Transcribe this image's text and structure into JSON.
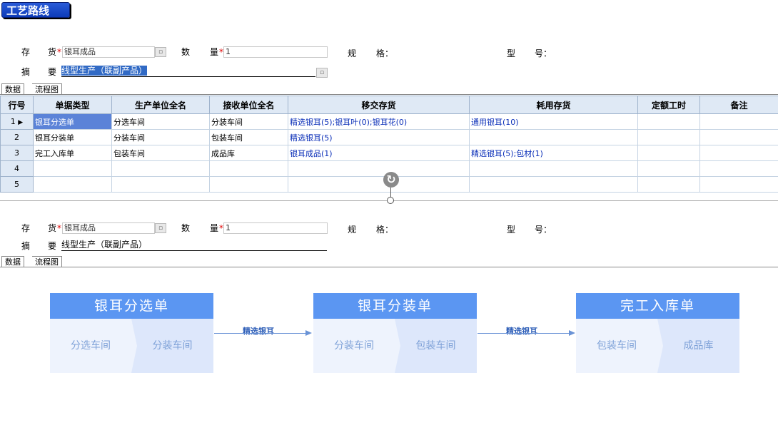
{
  "title": "工艺路线",
  "form": {
    "inventory_label_a": "存",
    "inventory_label_b": "货",
    "inventory_value": "银耳成品",
    "quantity_label_a": "数",
    "quantity_label_b": "量",
    "quantity_value": "1",
    "spec_label_a": "规",
    "spec_label_b": "格：",
    "model_label_a": "型",
    "model_label_b": "号：",
    "summary_label_a": "摘",
    "summary_label_b": "要",
    "summary_value": "线型生产（联副产品）",
    "required_mark": "*",
    "lookup_glyph": "▫"
  },
  "tabs": {
    "data": "数据",
    "flow": "流程图"
  },
  "grid": {
    "headers": [
      "行号",
      "单据类型",
      "生产单位全名",
      "接收单位全名",
      "移交存货",
      "耗用存货",
      "定额工时",
      "备注"
    ],
    "rows": [
      {
        "no": "1",
        "type": "银耳分选单",
        "prod": "分选车间",
        "recv": "分装车间",
        "transfer": "精选银耳(5);银耳叶(0);银耳花(0)",
        "consume": "通用银耳(10)"
      },
      {
        "no": "2",
        "type": "银耳分装单",
        "prod": "分装车间",
        "recv": "包装车间",
        "transfer": "精选银耳(5)",
        "consume": ""
      },
      {
        "no": "3",
        "type": "完工入库单",
        "prod": "包装车间",
        "recv": "成品库",
        "transfer": "银耳成品(1)",
        "consume": "精选银耳(5);包材(1)"
      },
      {
        "no": "4",
        "type": "",
        "prod": "",
        "recv": "",
        "transfer": "",
        "consume": ""
      },
      {
        "no": "5",
        "type": "",
        "prod": "",
        "recv": "",
        "transfer": "",
        "consume": ""
      }
    ],
    "current_row_marker": "▶"
  },
  "flow": {
    "nodes": [
      {
        "title": "银耳分选单",
        "left": "分选车间",
        "right": "分装车间"
      },
      {
        "title": "银耳分装单",
        "left": "分装车间",
        "right": "包装车间"
      },
      {
        "title": "完工入库单",
        "left": "包装车间",
        "right": "成品库"
      }
    ],
    "edges": [
      "精选银耳",
      "精选银耳"
    ]
  },
  "colors": {
    "node_header": "#5b96f2",
    "highlight_cell": "#5b83d8",
    "link_text": "#0b2fb8"
  }
}
